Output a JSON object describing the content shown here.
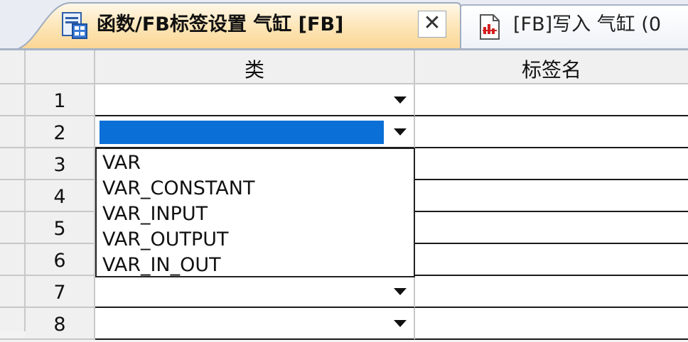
{
  "tabs": [
    {
      "label": "函数/FB标签设置 气缸 [FB]",
      "active": true,
      "icon": "fb-label-settings-icon"
    },
    {
      "label": "[FB]写入 气缸 (0",
      "active": false,
      "icon": "program-doc-icon"
    }
  ],
  "close_symbol": "✕",
  "grid": {
    "columns": [
      "类",
      "标签名"
    ],
    "rows": [
      "1",
      "2",
      "3",
      "4",
      "5",
      "6",
      "7",
      "8"
    ],
    "selected_row": "2"
  },
  "dropdown": {
    "options": [
      "VAR",
      "VAR_CONSTANT",
      "VAR_INPUT",
      "VAR_OUTPUT",
      "VAR_IN_OUT"
    ]
  },
  "colors": {
    "active_tab": "#fbd897",
    "selection": "#0a6fd6",
    "grid_header": "#f0f0f0"
  }
}
